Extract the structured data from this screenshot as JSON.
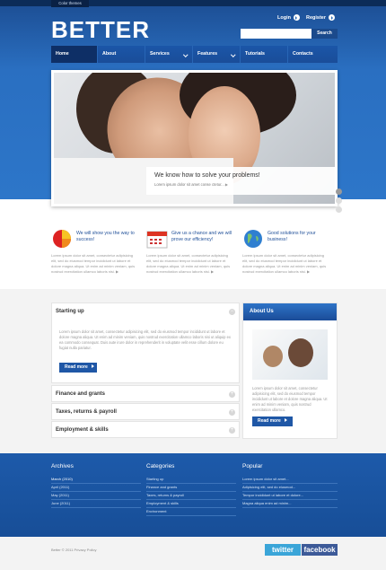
{
  "header": {
    "theme_tab": "Color themes",
    "logo": "BETTER",
    "login": "Login",
    "register": "Register",
    "search_button": "Search"
  },
  "nav": [
    "Home",
    "About",
    "Services",
    "Features",
    "Tutorials",
    "Contacts"
  ],
  "hero": {
    "caption_title": "We know how to solve your problems!",
    "caption_text": "Lorem ipsum dolor sit amet conse ctetur..."
  },
  "features": [
    {
      "title": "We will show you the way to success!",
      "text": "Lorem ipsum dolor sit amet, consectetur adipisicing elit, sed do eiusmod tempor incididunt ut labore et dolore magna aliqua. Ut enim ad minim veniam, quis nostrud exercitation ullamco laboris nisi."
    },
    {
      "title": "Give us a chance and we will prove our efficiency!",
      "text": "Lorem ipsum dolor sit amet, consectetur adipisicing elit, sed do eiusmod tempor incididunt ut labore et dolore magna aliqua. Ut enim ad minim veniam, quis nostrud exercitation ullamco laboris nisi."
    },
    {
      "title": "Good solutions for your business!",
      "text": "Lorem ipsum dolor sit amet, consectetur adipisicing elit, sed do eiusmod tempor incididunt ut labore et dolore magna aliqua. Ut enim ad minim veniam, quis nostrud exercitation ullamco laboris nisi."
    }
  ],
  "accordion": {
    "open_title": "Starting up",
    "open_text": "Lorem ipsum dolor sit amet, consectetur adipisicing elit, sed do eiusmod tempor incididunt ut labore et dolore magna aliqua. Ut enim ad minim veniam, quis nostrud exercitation ullamco laboris nisi ut aliquip ex ea commodo consequat. Duis aute irure dolor in reprehenderit in voluptate velit esse cillum dolore eu fugiat nulla pariatur.",
    "read_more": "Read more",
    "items": [
      "Finance and grants",
      "Taxes, returns & payroll",
      "Employment & skills"
    ]
  },
  "about": {
    "title": "About Us",
    "text": "Lorem ipsum dolor sit amet, consectetur adipisicing elit, sed do eiusmod tempor incididunt ut labore et dolore magna aliqua. Ut enim ad minim veniam, quis nostrud exercitation ullamco.",
    "read_more": "Read more"
  },
  "footer": {
    "archives_title": "Archives",
    "archives": [
      "March (2010)",
      "April (2011)",
      "May (2011)",
      "June (2011)"
    ],
    "categories_title": "Categories",
    "categories": [
      "Starting up",
      "Finance and grants",
      "Taxes, returns & payroll",
      "Employment & skills",
      "Environment"
    ],
    "popular_title": "Popular",
    "popular": [
      "Lorem ipsum dolor sit amet...",
      "Adipisicing elit, sed do eiusmod...",
      "Tempor incididunt ut labore et dolore...",
      "Magna aliqua enim ad minim..."
    ],
    "copyright": "Better © 2011   Privacy Policy",
    "twitter": "twitter",
    "facebook": "facebook"
  }
}
